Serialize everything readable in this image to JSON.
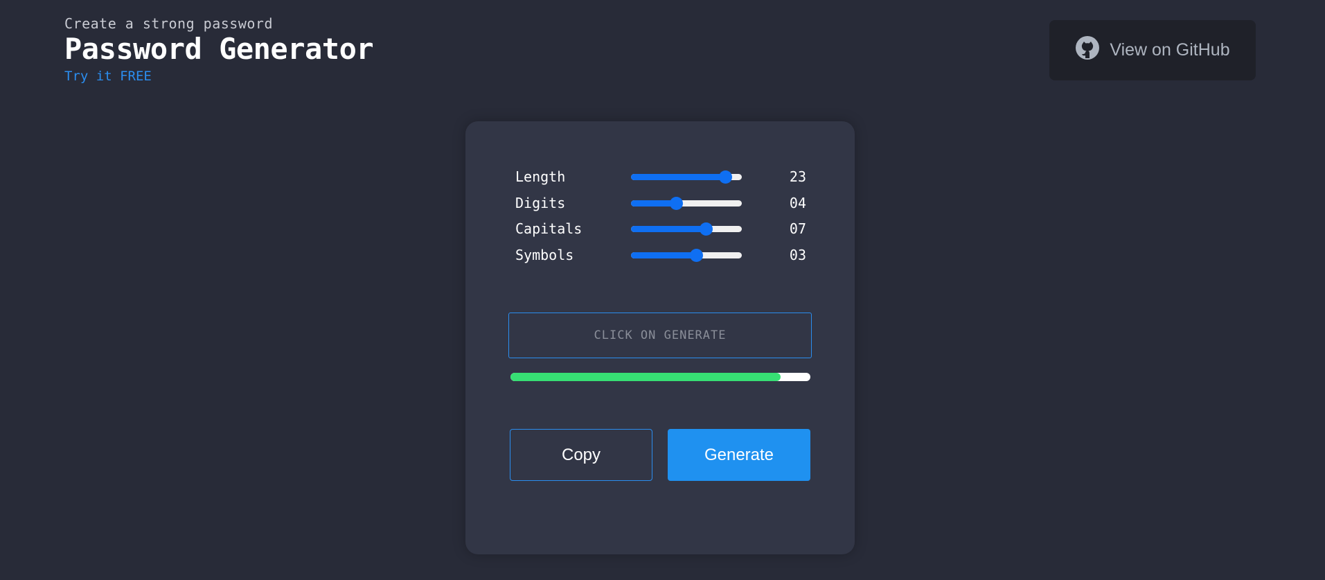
{
  "header": {
    "subtitle": "Create a strong password",
    "title": "Password Generator",
    "tagline": "Try it FREE"
  },
  "github": {
    "label": "View on GitHub",
    "icon": "github-icon"
  },
  "settings": [
    {
      "label": "Length",
      "value": "23",
      "fraction": 0.85
    },
    {
      "label": "Digits",
      "value": "04",
      "fraction": 0.41
    },
    {
      "label": "Capitals",
      "value": "07",
      "fraction": 0.68
    },
    {
      "label": "Symbols",
      "value": "03",
      "fraction": 0.59
    }
  ],
  "output": {
    "placeholder": "CLICK ON GENERATE"
  },
  "strength": {
    "fraction": 0.9
  },
  "buttons": {
    "copy": "Copy",
    "generate": "Generate"
  },
  "colors": {
    "background": "#282b38",
    "card": "#323646",
    "accent": "#1f91f0",
    "slider": "#0f6ff2",
    "strength": "#37df74"
  }
}
